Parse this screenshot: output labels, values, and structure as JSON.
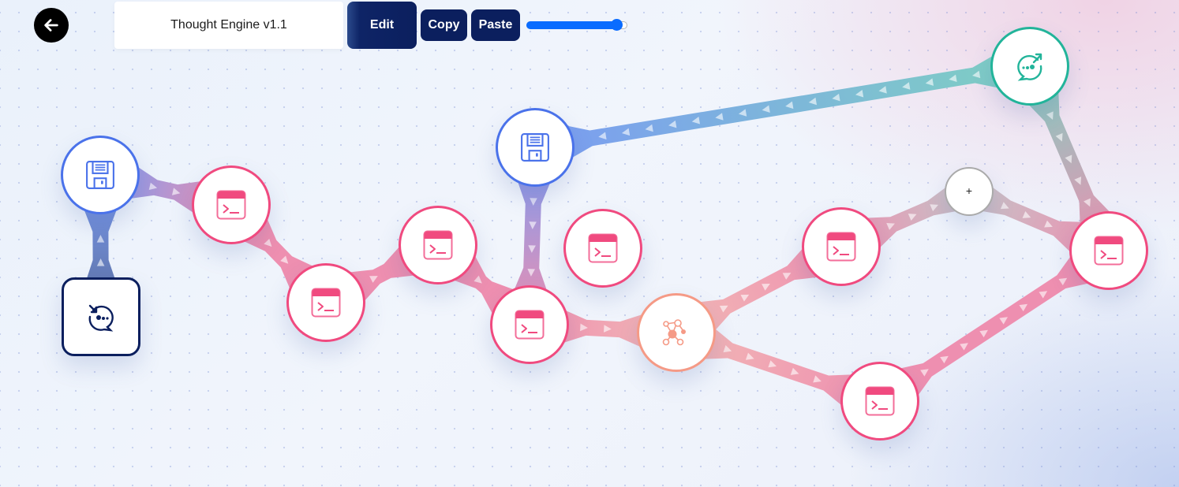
{
  "toolbar": {
    "back_icon": "arrow-left-icon",
    "title": "Thought Engine v1.1",
    "edit_label": "Edit",
    "copy_label": "Copy",
    "paste_label": "Paste",
    "zoom_slider_value": 0.85
  },
  "colors": {
    "memory": "#4a72ea",
    "terminal": "#f04a7f",
    "network": "#f59a86",
    "output": "#22b49a",
    "input": "#0b1f5e",
    "add": "#aaaaaa",
    "button": "#0b1f5e",
    "slider": "#0a6cff"
  },
  "nodes": [
    {
      "id": "input",
      "type": "input",
      "icon": "chat-refresh-icon"
    },
    {
      "id": "mem1",
      "type": "memory",
      "icon": "floppy-disk-icon"
    },
    {
      "id": "t1",
      "type": "terminal",
      "icon": "terminal-icon"
    },
    {
      "id": "t2",
      "type": "terminal",
      "icon": "terminal-icon"
    },
    {
      "id": "t3",
      "type": "terminal",
      "icon": "terminal-icon"
    },
    {
      "id": "mem2",
      "type": "memory",
      "icon": "floppy-disk-icon"
    },
    {
      "id": "t4",
      "type": "terminal",
      "icon": "terminal-icon"
    },
    {
      "id": "t5",
      "type": "terminal",
      "icon": "terminal-icon"
    },
    {
      "id": "net",
      "type": "network",
      "icon": "network-icon"
    },
    {
      "id": "t6",
      "type": "terminal",
      "icon": "terminal-icon"
    },
    {
      "id": "add",
      "type": "add",
      "icon": "plus-icon",
      "label": "+"
    },
    {
      "id": "t7",
      "type": "terminal",
      "icon": "terminal-icon"
    },
    {
      "id": "t8",
      "type": "terminal",
      "icon": "terminal-icon"
    },
    {
      "id": "out",
      "type": "output",
      "icon": "chat-share-icon"
    }
  ],
  "edges": [
    {
      "from": "input",
      "to": "mem1"
    },
    {
      "from": "mem1",
      "to": "t1"
    },
    {
      "from": "t1",
      "to": "t2"
    },
    {
      "from": "t2",
      "to": "t3"
    },
    {
      "from": "t3",
      "to": "t4"
    },
    {
      "from": "mem2",
      "to": "t4"
    },
    {
      "from": "t4",
      "to": "net"
    },
    {
      "from": "net",
      "to": "t6"
    },
    {
      "from": "net",
      "to": "t8"
    },
    {
      "from": "t6",
      "to": "add"
    },
    {
      "from": "add",
      "to": "t7"
    },
    {
      "from": "t8",
      "to": "t7"
    },
    {
      "from": "out",
      "to": "t7"
    },
    {
      "from": "out",
      "to": "mem2"
    }
  ]
}
